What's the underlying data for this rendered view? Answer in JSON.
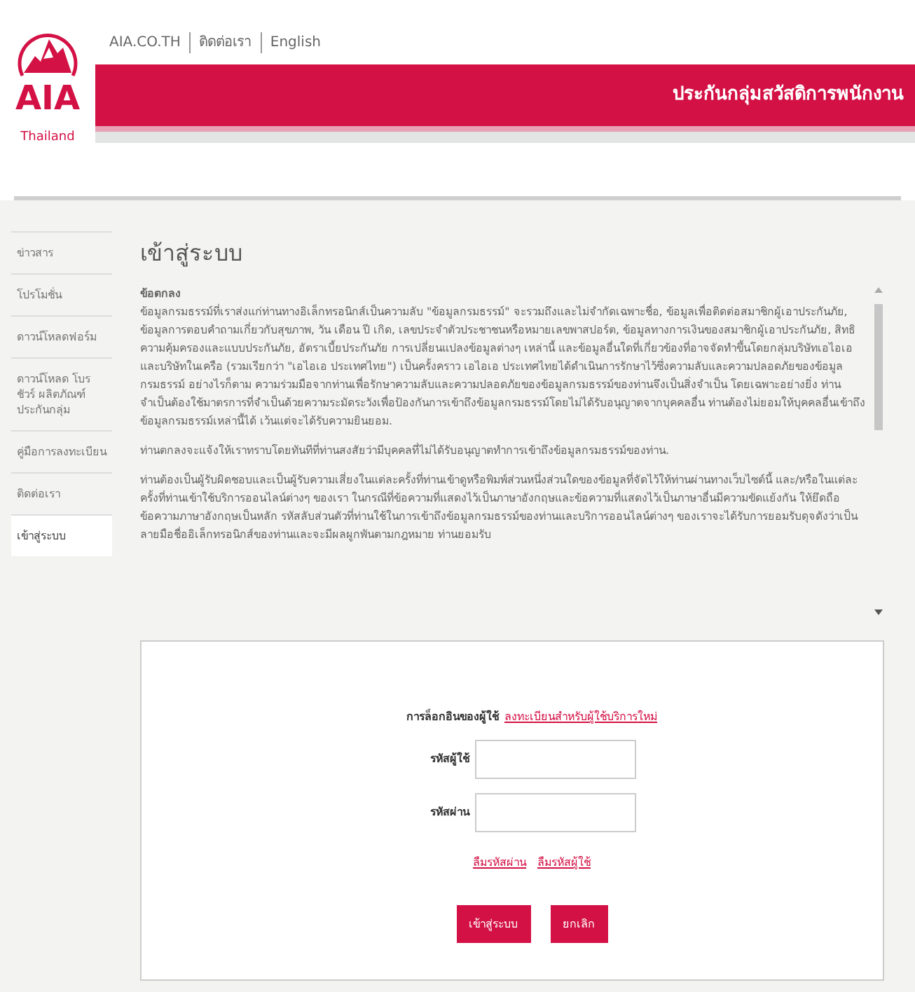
{
  "header": {
    "logo_text": "AIA",
    "logo_caption": "Thailand",
    "top_links": [
      "AIA.CO.TH",
      "ติดต่อเรา",
      "English"
    ],
    "banner_title": "ประกันกลุ่มสวัสดิการพนักงาน"
  },
  "sidebar": {
    "items": [
      {
        "label": "ข่าวสาร",
        "selected": false
      },
      {
        "label": "โปรโมชั่น",
        "selected": false
      },
      {
        "label": "ดาวน์โหลดฟอร์ม",
        "selected": false
      },
      {
        "label": "ดาวน์โหลด โบรชัวร์ ผลิตภัณฑ์ประกันกลุ่ม",
        "selected": false
      },
      {
        "label": "คู่มือการลงทะเบียน",
        "selected": false
      },
      {
        "label": "ติดต่อเรา",
        "selected": false
      },
      {
        "label": "เข้าสู่ระบบ",
        "selected": true
      }
    ]
  },
  "page_title": "เข้าสู่ระบบ",
  "terms": {
    "heading": "ข้อตกลง",
    "paragraphs": [
      "ข้อมูลกรมธรรม์ที่เราส่งแก่ท่านทางอิเล็กทรอนิกส์เป็นความลับ \"ข้อมูลกรมธรรม์\" จะรวมถึงและไม่จำกัดเฉพาะชื่อ, ข้อมูลเพื่อติดต่อสมาชิกผู้เอาประกันภัย, ข้อมูลการตอบคำถามเกี่ยวกับสุขภาพ, วัน เดือน ปี เกิด, เลขประจำตัวประชาชนหรือหมายเลขพาสปอร์ต, ข้อมูลทางการเงินของสมาชิกผู้เอาประกันภัย, สิทธิความคุ้มครองและแบบประกันภัย, อัตราเบี้ยประกันภัย การเปลี่ยนแปลงข้อมูลต่างๆ เหล่านี้ และข้อมูลอื่นใดที่เกี่ยวข้องที่อาจจัดทำขึ้นโดยกลุ่มบริษัทเอไอเอ และบริษัทในเครือ (รวมเรียกว่า \"เอไอเอ ประเทศไทย\") เป็นครั้งคราว เอไอเอ ประเทศไทยได้ดำเนินการรักษาไว้ซึ่งความลับและความปลอดภัยของข้อมูลกรมธรรม์ อย่างไรก็ตาม ความร่วมมือจากท่านเพื่อรักษาความลับและความปลอดภัยของข้อมูลกรมธรรม์ของท่านจึงเป็นสิ่งจำเป็น โดยเฉพาะอย่างยิ่ง ท่านจำเป็นต้องใช้มาตรการที่จำเป็นด้วยความระมัดระวังเพื่อป้องกันการเข้าถึงข้อมูลกรมธรรม์โดยไม่ได้รับอนุญาตจากบุคคลอื่น ท่านต้องไม่ยอมให้บุคคลอื่นเข้าถึงข้อมูลกรมธรรม์เหล่านี้ได้ เว้นแต่จะได้รับความยินยอม.",
      "ท่านตกลงจะแจ้งให้เราทราบโดยทันทีที่ท่านสงสัยว่ามีบุคคลที่ไม่ได้รับอนุญาตทำการเข้าถึงข้อมูลกรมธรรม์ของท่าน.",
      "ท่านต้องเป็นผู้รับผิดชอบและเป็นผู้รับความเสี่ยงในแต่ละครั้งที่ท่านเข้าดูหรือพิมพ์ส่วนหนึ่งส่วนใดของข้อมูลที่จัดไว้ให้ท่านผ่านทางเว็บไซต์นี้ และ/หรือในแต่ละครั้งที่ท่านเข้าใช้บริการออนไลน์ต่างๆ ของเรา ในกรณีที่ข้อความที่แสดงไว้เป็นภาษาอังกฤษและข้อความที่แสดงไว้เป็นภาษาอื่นมีความขัดแย้งกัน ให้ยึดถือข้อความภาษาอังกฤษเป็นหลัก รหัสลับส่วนตัวที่ท่านใช้ในการเข้าถึงข้อมูลกรมธรรม์ของท่านและบริการออนไลน์ต่างๆ ของเราจะได้รับการยอมรับดุจดังว่าเป็นลายมือชื่ออิเล็กทรอนิกส์ของท่านและจะมีผลผูกพันตามกฎหมาย ท่านยอมรับ"
    ]
  },
  "login": {
    "new_user_label": "การล็อกอินของผู้ใช้",
    "register_link": "ลงทะเบียนสำหรับผู้ใช้บริการใหม่",
    "fields": [
      {
        "label": "รหัสผู้ใช้"
      },
      {
        "label": "รหัสผ่าน"
      }
    ],
    "help_links": [
      "ลืมรหัสผ่าน",
      "ลืมรหัสผู้ใช้"
    ],
    "buttons": [
      "เข้าสู่ระบบ",
      "ยกเลิก"
    ]
  }
}
